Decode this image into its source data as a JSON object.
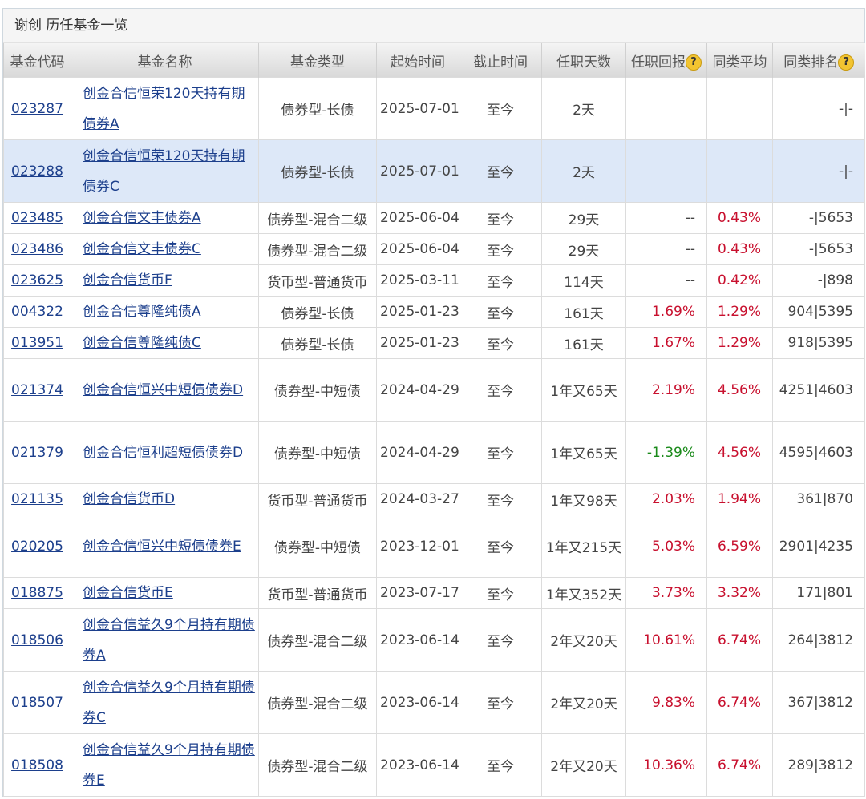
{
  "title": "谢创 历任基金一览",
  "headers": [
    "基金代码",
    "基金名称",
    "基金类型",
    "起始时间",
    "截止时间",
    "任职天数",
    "任职回报",
    "同类平均",
    "同类排名"
  ],
  "rows": [
    {
      "code": "023287",
      "name": "创金合信恒荣120天持有期债券A",
      "type": "债券型-长债",
      "start": "2025-07-01",
      "end": "至今",
      "days": "2天",
      "ret": "",
      "avg": "",
      "rank": "-|-",
      "two": true,
      "hl": false
    },
    {
      "code": "023288",
      "name": "创金合信恒荣120天持有期债券C",
      "type": "债券型-长债",
      "start": "2025-07-01",
      "end": "至今",
      "days": "2天",
      "ret": "",
      "avg": "",
      "rank": "-|-",
      "two": true,
      "hl": true
    },
    {
      "code": "023485",
      "name": "创金合信文丰债券A",
      "type": "债券型-混合二级",
      "start": "2025-06-04",
      "end": "至今",
      "days": "29天",
      "ret": "--",
      "avg": "0.43%",
      "rank": "-|5653"
    },
    {
      "code": "023486",
      "name": "创金合信文丰债券C",
      "type": "债券型-混合二级",
      "start": "2025-06-04",
      "end": "至今",
      "days": "29天",
      "ret": "--",
      "avg": "0.43%",
      "rank": "-|5653"
    },
    {
      "code": "023625",
      "name": "创金合信货币F",
      "type": "货币型-普通货币",
      "start": "2025-03-11",
      "end": "至今",
      "days": "114天",
      "ret": "--",
      "avg": "0.42%",
      "rank": "-|898"
    },
    {
      "code": "004322",
      "name": "创金合信尊隆纯债A",
      "type": "债券型-长债",
      "start": "2025-01-23",
      "end": "至今",
      "days": "161天",
      "ret": "1.69%",
      "avg": "1.29%",
      "rank": "904|5395"
    },
    {
      "code": "013951",
      "name": "创金合信尊隆纯债C",
      "type": "债券型-长债",
      "start": "2025-01-23",
      "end": "至今",
      "days": "161天",
      "ret": "1.67%",
      "avg": "1.29%",
      "rank": "918|5395"
    },
    {
      "code": "021374",
      "name": "创金合信恒兴中短债债券D",
      "type": "债券型-中短债",
      "start": "2024-04-29",
      "end": "至今",
      "days": "1年又65天",
      "ret": "2.19%",
      "avg": "4.56%",
      "rank": "4251|4603",
      "two": true
    },
    {
      "code": "021379",
      "name": "创金合信恒利超短债债券D",
      "type": "债券型-中短债",
      "start": "2024-04-29",
      "end": "至今",
      "days": "1年又65天",
      "ret": "-1.39%",
      "avg": "4.56%",
      "rank": "4595|4603",
      "two": true
    },
    {
      "code": "021135",
      "name": "创金合信货币D",
      "type": "货币型-普通货币",
      "start": "2024-03-27",
      "end": "至今",
      "days": "1年又98天",
      "ret": "2.03%",
      "avg": "1.94%",
      "rank": "361|870"
    },
    {
      "code": "020205",
      "name": "创金合信恒兴中短债债券E",
      "type": "债券型-中短债",
      "start": "2023-12-01",
      "end": "至今",
      "days": "1年又215天",
      "ret": "5.03%",
      "avg": "6.59%",
      "rank": "2901|4235",
      "two": true
    },
    {
      "code": "018875",
      "name": "创金合信货币E",
      "type": "货币型-普通货币",
      "start": "2023-07-17",
      "end": "至今",
      "days": "1年又352天",
      "ret": "3.73%",
      "avg": "3.32%",
      "rank": "171|801"
    },
    {
      "code": "018506",
      "name": "创金合信益久9个月持有期债券A",
      "type": "债券型-混合二级",
      "start": "2023-06-14",
      "end": "至今",
      "days": "2年又20天",
      "ret": "10.61%",
      "avg": "6.74%",
      "rank": "264|3812",
      "two": true
    },
    {
      "code": "018507",
      "name": "创金合信益久9个月持有期债券C",
      "type": "债券型-混合二级",
      "start": "2023-06-14",
      "end": "至今",
      "days": "2年又20天",
      "ret": "9.83%",
      "avg": "6.74%",
      "rank": "367|3812",
      "two": true
    },
    {
      "code": "018508",
      "name": "创金合信益久9个月持有期债券E",
      "type": "债券型-混合二级",
      "start": "2023-06-14",
      "end": "至今",
      "days": "2年又20天",
      "ret": "10.36%",
      "avg": "6.74%",
      "rank": "289|3812",
      "two": true
    }
  ],
  "help_icon": "?",
  "colors": {
    "link": "#1c3f8c",
    "positive": "#c8102e",
    "negative": "#1a8a1a",
    "highlight": "#dde8f8"
  }
}
